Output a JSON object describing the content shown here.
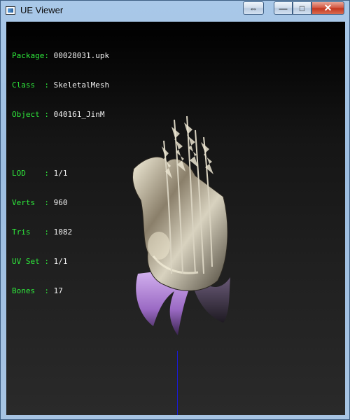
{
  "window": {
    "title": "UE Viewer",
    "controls": {
      "swap": "⇔",
      "minimize": "—",
      "maximize": "□",
      "close": "✕"
    }
  },
  "info": [
    {
      "label": "Package",
      "sep": ": ",
      "value": "00028031.upk"
    },
    {
      "label": "Class  ",
      "sep": ": ",
      "value": "SkeletalMesh"
    },
    {
      "label": "Object ",
      "sep": ": ",
      "value": "040161_JinM"
    },
    {
      "label": "LOD    ",
      "sep": ": ",
      "value": "1/1"
    },
    {
      "label": "Verts  ",
      "sep": ": ",
      "value": "960"
    },
    {
      "label": "Tris   ",
      "sep": ": ",
      "value": "1082"
    },
    {
      "label": "UV Set ",
      "sep": ": ",
      "value": "1/1"
    },
    {
      "label": "Bones  ",
      "sep": ": ",
      "value": "17"
    }
  ],
  "colors": {
    "label": "#2ee83b",
    "value": "#f2f2f2",
    "axis": "#1a1ad8",
    "hair": "#b48ad8",
    "metal": "#c8c3b0"
  },
  "model": {
    "subject": "ornate metallic helmet with purple hair"
  }
}
